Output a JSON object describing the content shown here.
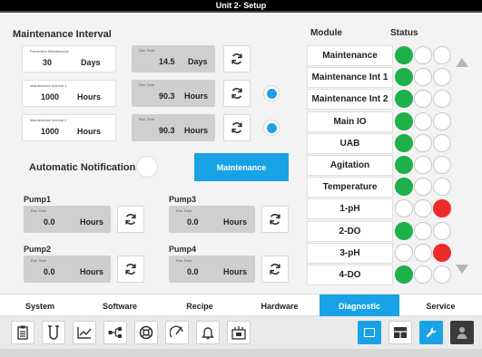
{
  "window": {
    "title": "Unit 2- Setup"
  },
  "maintenance_interval": {
    "title": "Maintenance Interval",
    "rows": [
      {
        "label": "Preventive Maintenance",
        "value": "30",
        "unit": "Days",
        "runtime_label": "Run Time",
        "runtime_value": "14.5",
        "runtime_unit": "Days",
        "selected": false
      },
      {
        "label": "Maintenance Interval 1",
        "value": "1000",
        "unit": "Hours",
        "runtime_label": "Run Time",
        "runtime_value": "90.3",
        "runtime_unit": "Hours",
        "selected": true
      },
      {
        "label": "Maintenance Interval 2",
        "value": "1000",
        "unit": "Hours",
        "runtime_label": "Run Time",
        "runtime_value": "90.3",
        "runtime_unit": "Hours",
        "selected": true
      }
    ]
  },
  "notification": {
    "label": "Automatic Notification",
    "maintenance_button": "Maintenance"
  },
  "pumps": [
    {
      "name": "Pump1",
      "runtime_label": "Run Time",
      "value": "0.0",
      "unit": "Hours"
    },
    {
      "name": "Pump2",
      "runtime_label": "Run Time",
      "value": "0.0",
      "unit": "Hours"
    },
    {
      "name": "Pump3",
      "runtime_label": "Run Time",
      "value": "0.0",
      "unit": "Hours"
    },
    {
      "name": "Pump4",
      "runtime_label": "Run Time",
      "value": "0.0",
      "unit": "Hours"
    }
  ],
  "status_panel": {
    "module_header": "Module",
    "status_header": "Status",
    "modules": [
      {
        "name": "Maintenance",
        "status": [
          "green",
          "off",
          "off"
        ]
      },
      {
        "name": "Maintenance Int 1",
        "status": [
          "green",
          "off",
          "off"
        ]
      },
      {
        "name": "Maintenance Int 2",
        "status": [
          "green",
          "off",
          "off"
        ]
      },
      {
        "name": "Main IO",
        "status": [
          "green",
          "off",
          "off"
        ]
      },
      {
        "name": "UAB",
        "status": [
          "green",
          "off",
          "off"
        ]
      },
      {
        "name": "Agitation",
        "status": [
          "green",
          "off",
          "off"
        ]
      },
      {
        "name": "Temperature",
        "status": [
          "green",
          "off",
          "off"
        ]
      },
      {
        "name": "1-pH",
        "status": [
          "off",
          "off",
          "red"
        ]
      },
      {
        "name": "2-DO",
        "status": [
          "green",
          "off",
          "off"
        ]
      },
      {
        "name": "3-pH",
        "status": [
          "off",
          "off",
          "red"
        ]
      },
      {
        "name": "4-DO",
        "status": [
          "green",
          "off",
          "off"
        ]
      }
    ]
  },
  "tabs": [
    {
      "label": "System",
      "active": false
    },
    {
      "label": "Software",
      "active": false
    },
    {
      "label": "Recipe",
      "active": false
    },
    {
      "label": "Hardware",
      "active": false
    },
    {
      "label": "Diagnostic",
      "active": true
    },
    {
      "label": "Service",
      "active": false
    }
  ],
  "toolbar": {
    "icons": [
      "clipboard-icon",
      "beaker-icon",
      "trend-chart-icon",
      "network-icon",
      "lifebuoy-icon",
      "gauge-icon",
      "bell-icon",
      "calibration-icon",
      "window-icon",
      "module-grid-icon",
      "wrench-icon",
      "user-icon"
    ]
  },
  "colors": {
    "accent": "#1aa2e6",
    "ok": "#1faf4b",
    "alarm": "#ee2b2b"
  }
}
